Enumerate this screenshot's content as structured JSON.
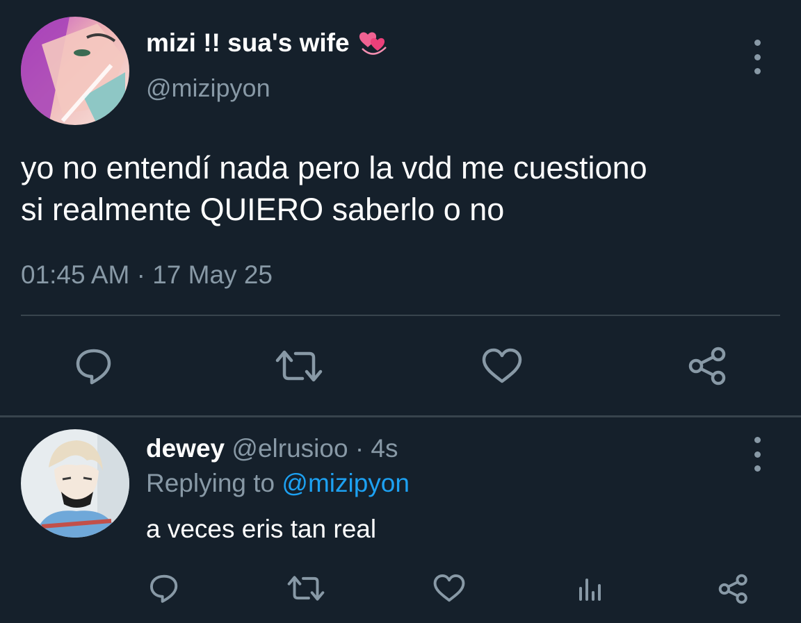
{
  "main_tweet": {
    "display_name": "mizi !! sua's wife",
    "name_emoji": "revolving-hearts-emoji",
    "handle": "@mizipyon",
    "text_line1": "yo no entendí nada pero la vdd me cuestiono",
    "text_line2": "si realmente QUIERO saberlo o no",
    "timestamp": "01:45 AM · 17 May 25",
    "actions": [
      "reply-icon",
      "retweet-icon",
      "like-icon",
      "share-icon"
    ]
  },
  "reply_tweet": {
    "display_name": "dewey",
    "handle_time": " @elrusioo · 4s",
    "replying_prefix": "Replying to ",
    "replying_mention": "@mizipyon",
    "text": "a veces eris tan real",
    "actions": [
      "reply-icon",
      "retweet-icon",
      "like-icon",
      "analytics-icon",
      "share-icon"
    ]
  },
  "colors": {
    "background": "#15202b",
    "primary_text": "#ffffff",
    "secondary_text": "#8899a6",
    "accent": "#1da1f2",
    "divider": "#38444d"
  }
}
